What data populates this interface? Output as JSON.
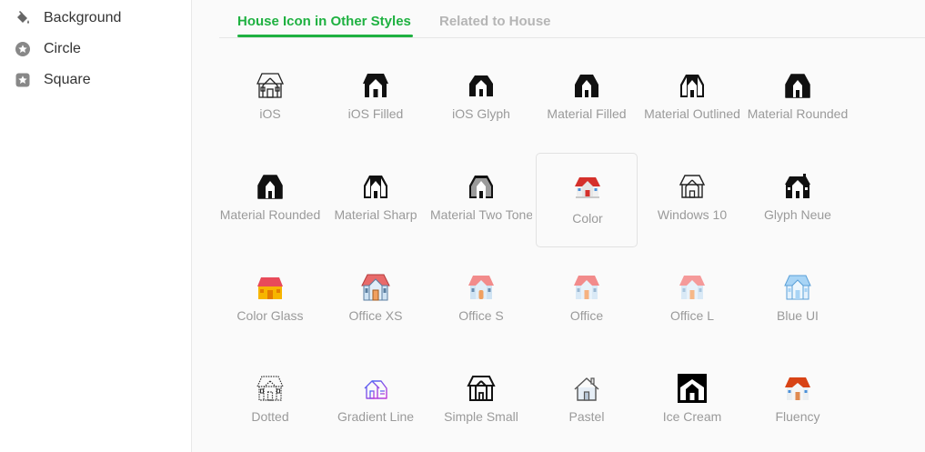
{
  "sidebar": {
    "items": [
      {
        "label": "Background",
        "icon": "paint-bucket-icon"
      },
      {
        "label": "Circle",
        "icon": "star-circle-icon"
      },
      {
        "label": "Square",
        "icon": "star-square-icon"
      }
    ]
  },
  "tabs": [
    {
      "label": "House Icon in Other Styles",
      "active": true
    },
    {
      "label": "Related to House",
      "active": false
    }
  ],
  "colors": {
    "accent": "#1fb141",
    "muted_text": "#9a9a9a"
  },
  "icons": [
    {
      "label": "iOS"
    },
    {
      "label": "iOS Filled"
    },
    {
      "label": "iOS Glyph"
    },
    {
      "label": "Material Filled"
    },
    {
      "label": "Material Outlined"
    },
    {
      "label": "Material Rounded"
    },
    {
      "label": "Material Rounded"
    },
    {
      "label": "Material Sharp"
    },
    {
      "label": "Material Two Tone"
    },
    {
      "label": "Color",
      "selected": true
    },
    {
      "label": "Windows 10"
    },
    {
      "label": "Glyph Neue"
    },
    {
      "label": "Color Glass"
    },
    {
      "label": "Office XS"
    },
    {
      "label": "Office S"
    },
    {
      "label": "Office"
    },
    {
      "label": "Office L"
    },
    {
      "label": "Blue UI"
    },
    {
      "label": "Dotted"
    },
    {
      "label": "Gradient Line"
    },
    {
      "label": "Simple Small"
    },
    {
      "label": "Pastel"
    },
    {
      "label": "Ice Cream"
    },
    {
      "label": "Fluency"
    }
  ]
}
